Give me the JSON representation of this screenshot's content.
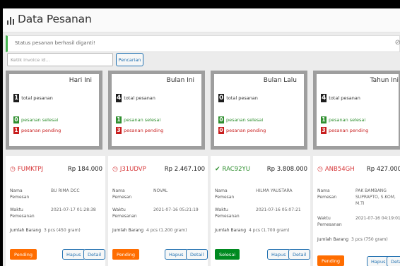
{
  "header": {
    "title": "Data Pesanan",
    "icon": "bar-chart-icon"
  },
  "alert": {
    "message": "Status pesanan berhasil diganti!",
    "dismiss_icon": "close-icon"
  },
  "search": {
    "placeholder": "Ketik invoice id...",
    "value": "",
    "button_label": "Pencarian"
  },
  "stats": [
    {
      "period": "Hari Ini",
      "total": "1",
      "total_label": "total pesanan",
      "done": "0",
      "done_label": "pesanan selesai",
      "pending": "1",
      "pending_label": "pesanan pending"
    },
    {
      "period": "Bulan Ini",
      "total": "4",
      "total_label": "total pesanan",
      "done": "1",
      "done_label": "pesanan selesai",
      "pending": "3",
      "pending_label": "pesanan pending"
    },
    {
      "period": "Bulan Lalu",
      "total": "0",
      "total_label": "total pesanan",
      "done": "0",
      "done_label": "pesanan selesai",
      "pending": "0",
      "pending_label": "pesanan pending"
    },
    {
      "period": "Tahun Ini",
      "total": "4",
      "total_label": "total pesanan",
      "done": "1",
      "done_label": "pesanan selesai",
      "pending": "3",
      "pending_label": "pesanan pending"
    }
  ],
  "labels": {
    "nama": "Nama Pemesan",
    "waktu": "Waktu Pemesanan",
    "jumlah": "Jumlah Barang",
    "hapus": "Hapus",
    "detail": "Detail"
  },
  "colors": {
    "pending_button": "#ff6d00",
    "done_button": "#008a20",
    "link_blue": "#2271b1",
    "alert_green": "#46b450"
  },
  "orders": [
    {
      "id": "FUMKTPJ",
      "status_icon": "clock-icon",
      "price": "Rp 184.000",
      "name": "BU RIMA DCC",
      "time": "2021-07-17 01:28:38",
      "qty": "3 pcs (450 gram)",
      "status": "Pending"
    },
    {
      "id": "J31UDVP",
      "status_icon": "clock-icon",
      "price": "Rp 2.467.100",
      "name": "NOVAL",
      "time": "2021-07-16 05:21:19",
      "qty": "4 pcs (1.200 gram)",
      "status": "Pending"
    },
    {
      "id": "RAC92YU",
      "status_icon": "check-icon",
      "price": "Rp 3.808.000",
      "name": "HILMA YAUSTARA",
      "time": "2021-07-16 05:07:21",
      "qty": "4 pcs (1.700 gram)",
      "status": "Selesai"
    },
    {
      "id": "ANB54GH",
      "status_icon": "clock-icon",
      "price": "Rp 427.000",
      "name": "PAK BAMBANG SUPRAPTO, S.KOM, M.TI",
      "time": "2021-07-16 04:19:01",
      "qty": "3 pcs (750 gram)",
      "status": "Pending"
    }
  ]
}
